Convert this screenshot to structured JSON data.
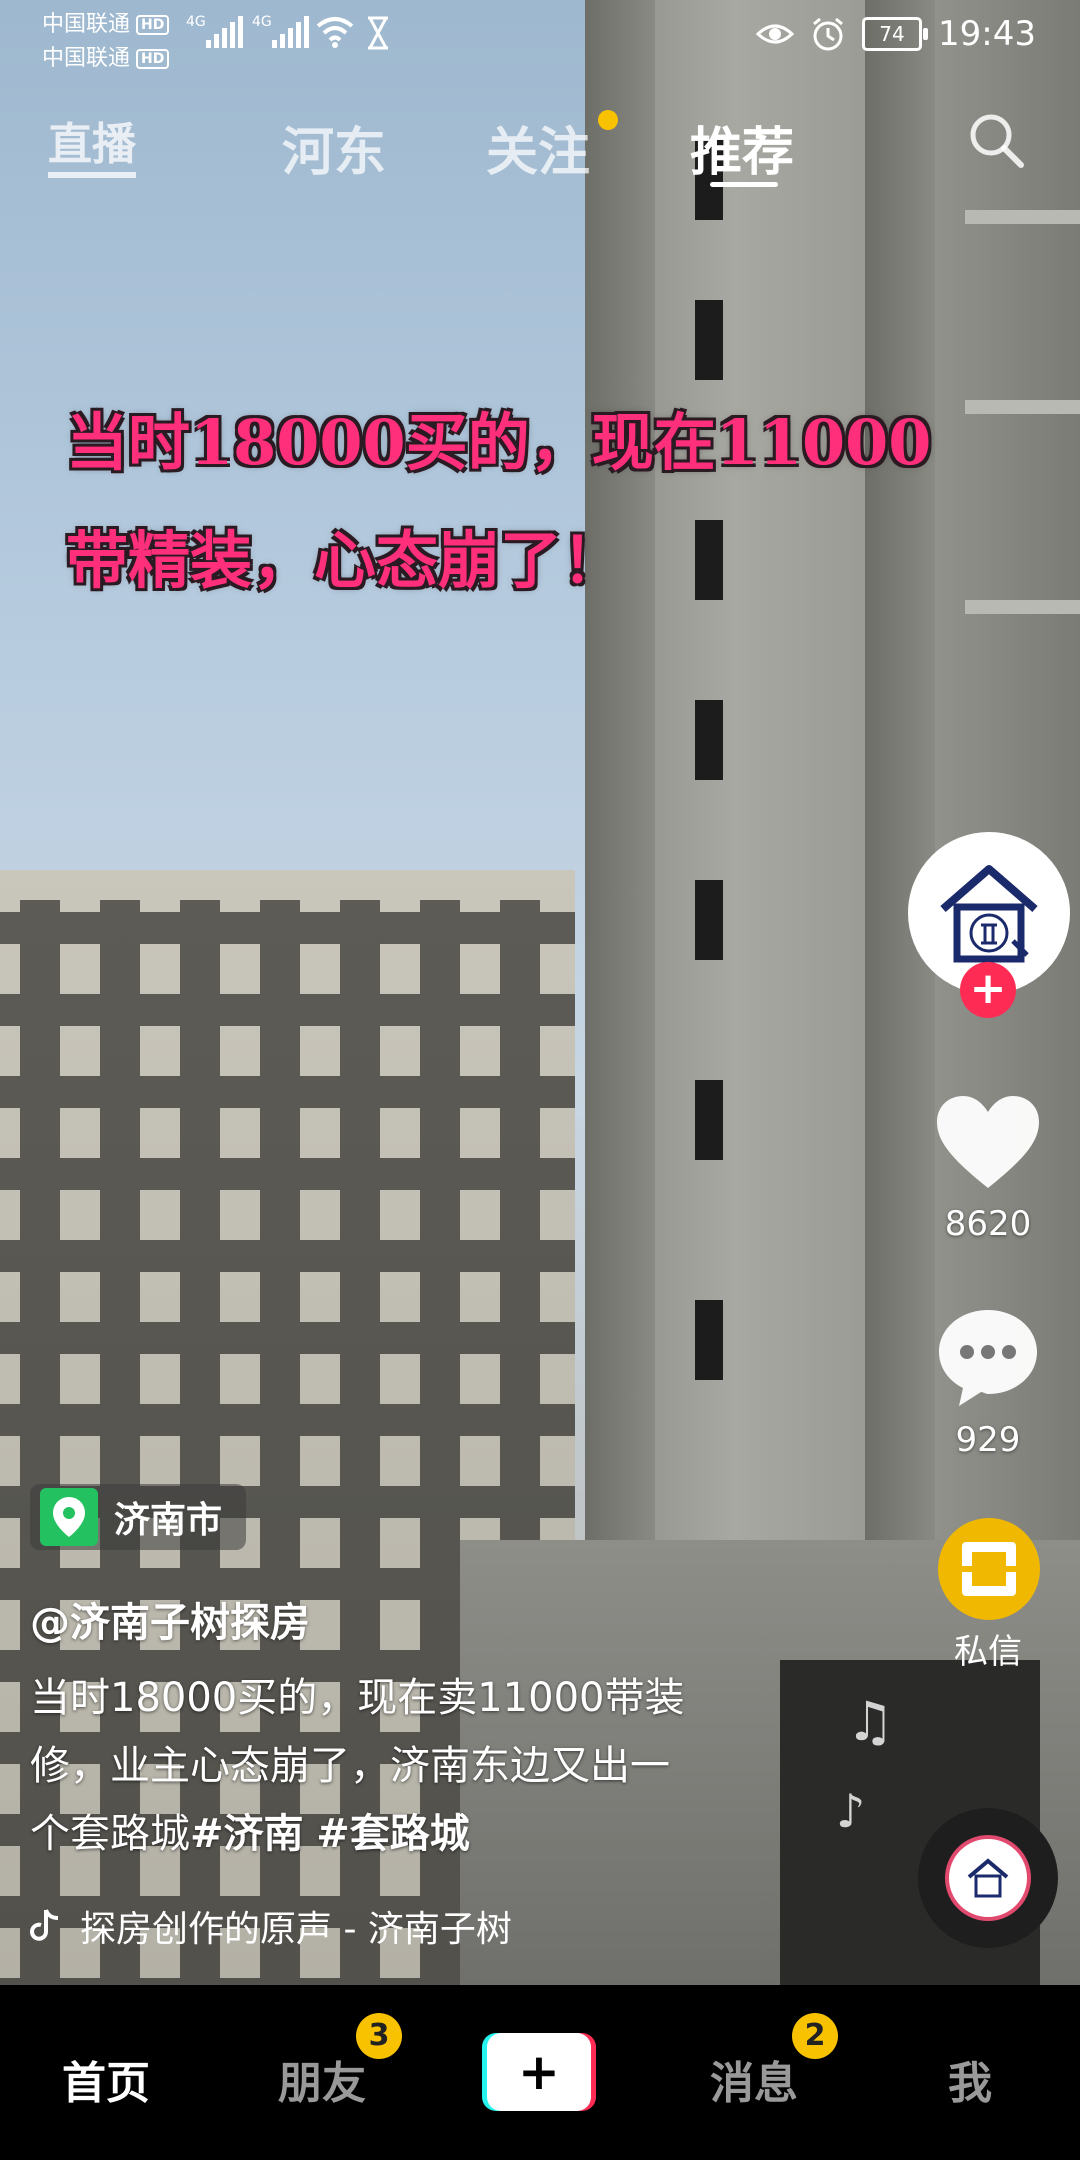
{
  "status_bar": {
    "carrier1": "中国联通",
    "carrier2": "中国联通",
    "hd": "HD",
    "network1": "4G",
    "network2": "4G",
    "battery": "74",
    "time": "19:43"
  },
  "top_nav": {
    "live": "直播",
    "tabs": [
      "河东",
      "关注",
      "推荐"
    ],
    "active_tab": "推荐"
  },
  "video": {
    "headline_line1": "当时18000买的，现在11000",
    "headline_line2": "带精装，心态崩了！",
    "location": "济南市",
    "author": "@济南子树探房",
    "desc_line1": "当时18000买的，现在卖11000带装",
    "desc_line2": "修，业主心态崩了，济南东边又出一",
    "desc_line3_prefix": "个套路城",
    "hashtag1": "#济南",
    "hashtag2": "#套路城",
    "music": "探房创作的原声 - 济南子树"
  },
  "actions": {
    "like_count": "8620",
    "comment_count": "929",
    "dm_label": "私信"
  },
  "tabbar": {
    "home": "首页",
    "friends": "朋友",
    "friends_badge": "3",
    "create": "+",
    "messages": "消息",
    "messages_badge": "2",
    "me": "我"
  },
  "colors": {
    "accent_red": "#fe2c55",
    "badge_yellow": "#f9c200",
    "headline_pink": "#ff2f7b",
    "location_green": "#23c160"
  }
}
